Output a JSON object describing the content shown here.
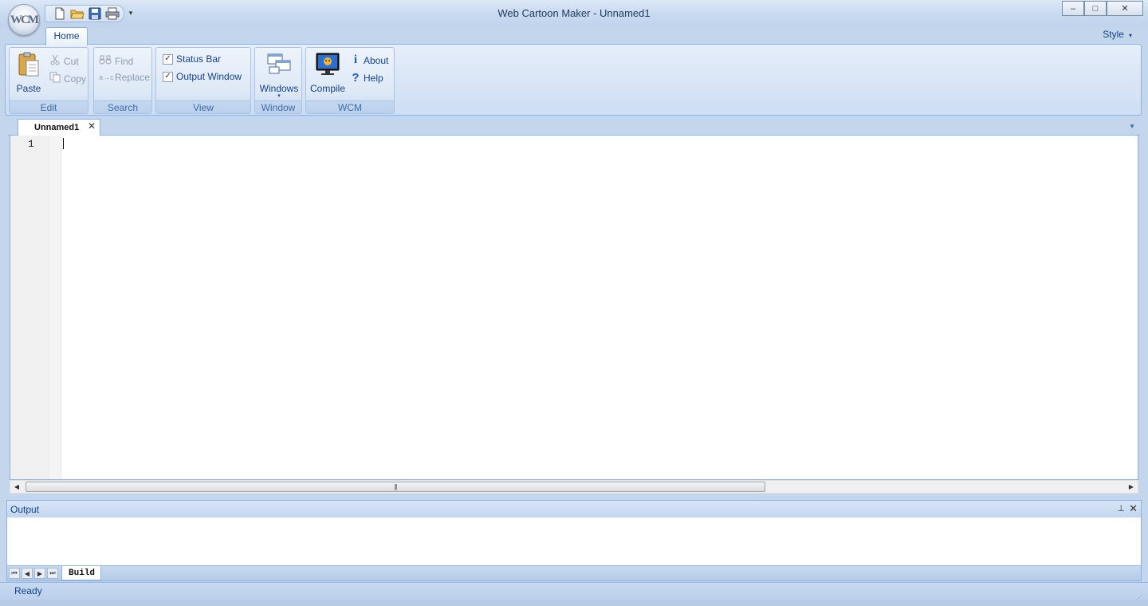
{
  "window": {
    "title": "Web Cartoon Maker - Unnamed1",
    "logo_text": "WCM",
    "controls": {
      "minimize": "–",
      "maximize": "□",
      "close": "✕"
    }
  },
  "quick_access": {
    "icons": [
      "new-file-icon",
      "open-folder-icon",
      "save-icon",
      "print-icon"
    ],
    "more": "▾"
  },
  "ribbon": {
    "tabs": [
      {
        "label": "Home",
        "active": true
      }
    ],
    "style_menu": {
      "label": "Style",
      "arrow": "▾"
    },
    "groups": {
      "edit": {
        "label": "Edit",
        "paste": "Paste",
        "cut": "Cut",
        "copy": "Copy"
      },
      "search": {
        "label": "Search",
        "find": "Find",
        "replace": "Replace"
      },
      "view": {
        "label": "View",
        "status_bar": {
          "label": "Status Bar",
          "checked": true
        },
        "output_window": {
          "label": "Output Window",
          "checked": true
        },
        "check_mark": "✓"
      },
      "window": {
        "label": "Window",
        "windows": "Windows",
        "arrow": "▾"
      },
      "wcm": {
        "label": "WCM",
        "compile": "Compile",
        "about": "About",
        "about_icon": "i",
        "help": "Help",
        "help_icon": "?"
      }
    }
  },
  "document": {
    "tab_label": "Unnamed1",
    "tab_close": "✕",
    "tabs_dropdown": "▼",
    "line_numbers": [
      "1"
    ],
    "content": ""
  },
  "scrollbar": {
    "left": "◀",
    "right": "▶",
    "grip": "|||"
  },
  "output": {
    "title": "Output",
    "pin": "⊥",
    "close": "✕",
    "nav": [
      "⏮",
      "◀",
      "▶",
      "⏭"
    ],
    "tabs": [
      {
        "label": "Build",
        "active": true
      }
    ]
  },
  "status_bar": {
    "text": "Ready",
    "grip": "⋰"
  },
  "colors": {
    "ribbon_text": "#15428b",
    "frame": "#c4d6ec",
    "border": "#8db2e3"
  }
}
